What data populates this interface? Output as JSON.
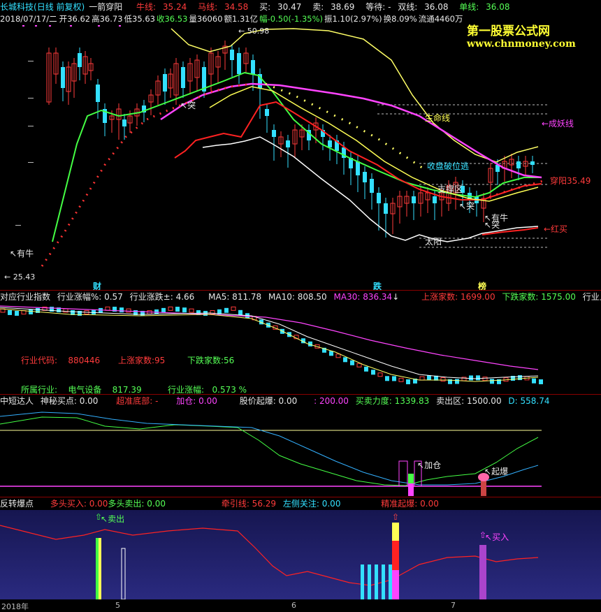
{
  "header": {
    "stock_name": "长城科技",
    "period": "(日线 前复权)",
    "formula": "一箭穿阳",
    "niu_label": "牛线: ",
    "niu_val": "35.24",
    "ma_label": "马线: ",
    "ma_val": "34.58",
    "buy_label": "买: ",
    "buy_val": "30.47",
    "sell_label": "卖: ",
    "sell_val": "38.69",
    "wait_label": "等待: - ",
    "shuang_label": "双线: ",
    "shuang_val": "36.08",
    "dan_label": "单线: ",
    "dan_val": "36.08",
    "date": "2018/07/17/二",
    "open": "开36.62",
    "high": "高36.73",
    "low": "低35.63",
    "close": "收36.53",
    "vol": "量36060",
    "amount": "额1.31亿",
    "change": "幅-0.50(-1.35%)",
    "amp": "振1.10(2.97%)",
    "turn": "换8.09%",
    "float": "流通4460万"
  },
  "watermark": {
    "line1": "第一股票公式网",
    "line2": "www.chnmoney.com"
  },
  "main_chart": {
    "labels": {
      "high_price": "50.98",
      "low_price": "25.43",
      "shengming": "生命线",
      "chengyao": "←成妖线",
      "shoupan": "收盘破位逃",
      "chuanyang": "穿阳",
      "chuanyang_val": "35.49",
      "zhichengqu": "支撑区",
      "youniu1": "有牛",
      "youniu2": "有牛",
      "tu1": "突",
      "tu2": "突",
      "tu3": "突",
      "taiyang": "太阳",
      "hongmai": "←红买",
      "cai": "财",
      "die": "跌",
      "bang": "榜"
    }
  },
  "industry_panel": {
    "title": "对应行业指数",
    "zhangfu": "行业涨幅%: 0.57",
    "zhangdie": "行业涨跌±: 4.66",
    "ma5": "MA5: 811.78",
    "ma10": "MA10: 808.50",
    "ma30": "MA30: 836.34",
    "up_count": "上涨家数: 1699.00",
    "down_count": "下跌家数: 1575.00",
    "tail": "行业上涨数",
    "code_label": "行业代码:",
    "code_val": "880446",
    "up_label": "上涨家数:95",
    "down_label": "下跌家数:56",
    "ind_label": "所属行业:",
    "ind_name": "电气设备",
    "ind_val": "817.39",
    "ind_zf_label": "行业涨幅:",
    "ind_zf_val": "0.573 %"
  },
  "zhongduan_panel": {
    "title": "中短达人",
    "shenmi": "神秘买点: 0.00",
    "chaozhun": "超准底部: -",
    "jiacang": "加仓: 0.00",
    "guqi": "股价起爆: 0.00",
    "val200": ": 200.00",
    "limai": "买卖力度: 1339.83",
    "maichu": "卖出区: 1500.00",
    "dval": "D: 558.74",
    "lbl_jiacang": "加仓",
    "lbl_qibao": "起爆"
  },
  "fanzhuan_panel": {
    "title": "反转爆点",
    "duotou_buy": "多头买入: 0.00",
    "duotou_sell": "多头卖出: 0.00",
    "qianyin": "牵引线: 56.29",
    "zuoce": "左侧关注: 0.00",
    "jingzhun": "精准起爆: 0.00",
    "lbl_maichu": "卖出",
    "lbl_mairu": "买入"
  },
  "axis": {
    "year": "2018年",
    "m5": "5",
    "m6": "6",
    "m7": "7"
  },
  "colors": {
    "bg": "#000000",
    "panel4_bg": "#1a1a60",
    "up": "#ff3b3b",
    "down": "#33e0ff",
    "separator": "#8b0000"
  }
}
